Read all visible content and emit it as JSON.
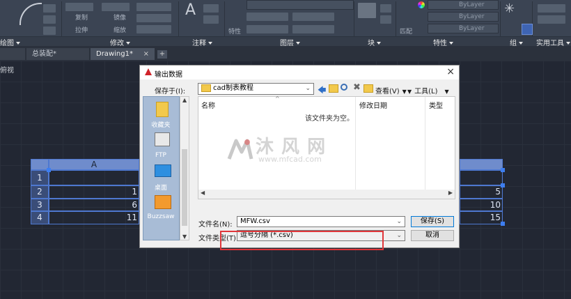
{
  "ribbon": {
    "panels": [
      {
        "label": "绘图"
      },
      {
        "label": "修改"
      },
      {
        "label": "注释"
      },
      {
        "label": "图层"
      },
      {
        "label": "块"
      },
      {
        "label": "特性"
      },
      {
        "label": "组"
      },
      {
        "label": "实用工具"
      }
    ],
    "modify_items": [
      "复制",
      "镜像",
      "拉伸",
      "缩放"
    ],
    "bylayer_1": "ByLayer",
    "bylayer_2": "ByLayer",
    "bylayer_3": "ByLayer",
    "side_labels": [
      "特性",
      "匹配"
    ]
  },
  "tabs": [
    {
      "label": "总装配*",
      "active": false
    },
    {
      "label": "Drawing1*",
      "active": true
    }
  ],
  "viewport_label": "俯视",
  "table": {
    "header": "A",
    "row_numbers": [
      "1",
      "2",
      "3",
      "4"
    ],
    "left_values": [
      "",
      "1",
      "6",
      "11"
    ],
    "right_values": [
      "",
      "5",
      "10",
      "15"
    ]
  },
  "dialog": {
    "title": "输出数据",
    "save_in_label": "保存于(I):",
    "save_in_value": "cad制表教程",
    "view_label": "查看(V)",
    "tools_label": "工具(L)",
    "places": [
      "收藏夹",
      "FTP",
      "桌面",
      "Buzzsaw"
    ],
    "columns": [
      "名称",
      "修改日期",
      "类型"
    ],
    "empty_message": "该文件夹为空。",
    "filename_label": "文件名(N):",
    "filename_value": "MFW.csv",
    "filetype_label": "文件类型(T):",
    "filetype_value": "逗号分隔 (*.csv)",
    "save_button": "保存(S)",
    "cancel_button": "取消"
  },
  "watermark": {
    "brand": "沐 风 网",
    "url": "www.mfcad.com"
  },
  "colors": {
    "accent_red": "#e0363a",
    "table_blue": "#4e78d0",
    "grip_blue": "#3d7ef0"
  }
}
